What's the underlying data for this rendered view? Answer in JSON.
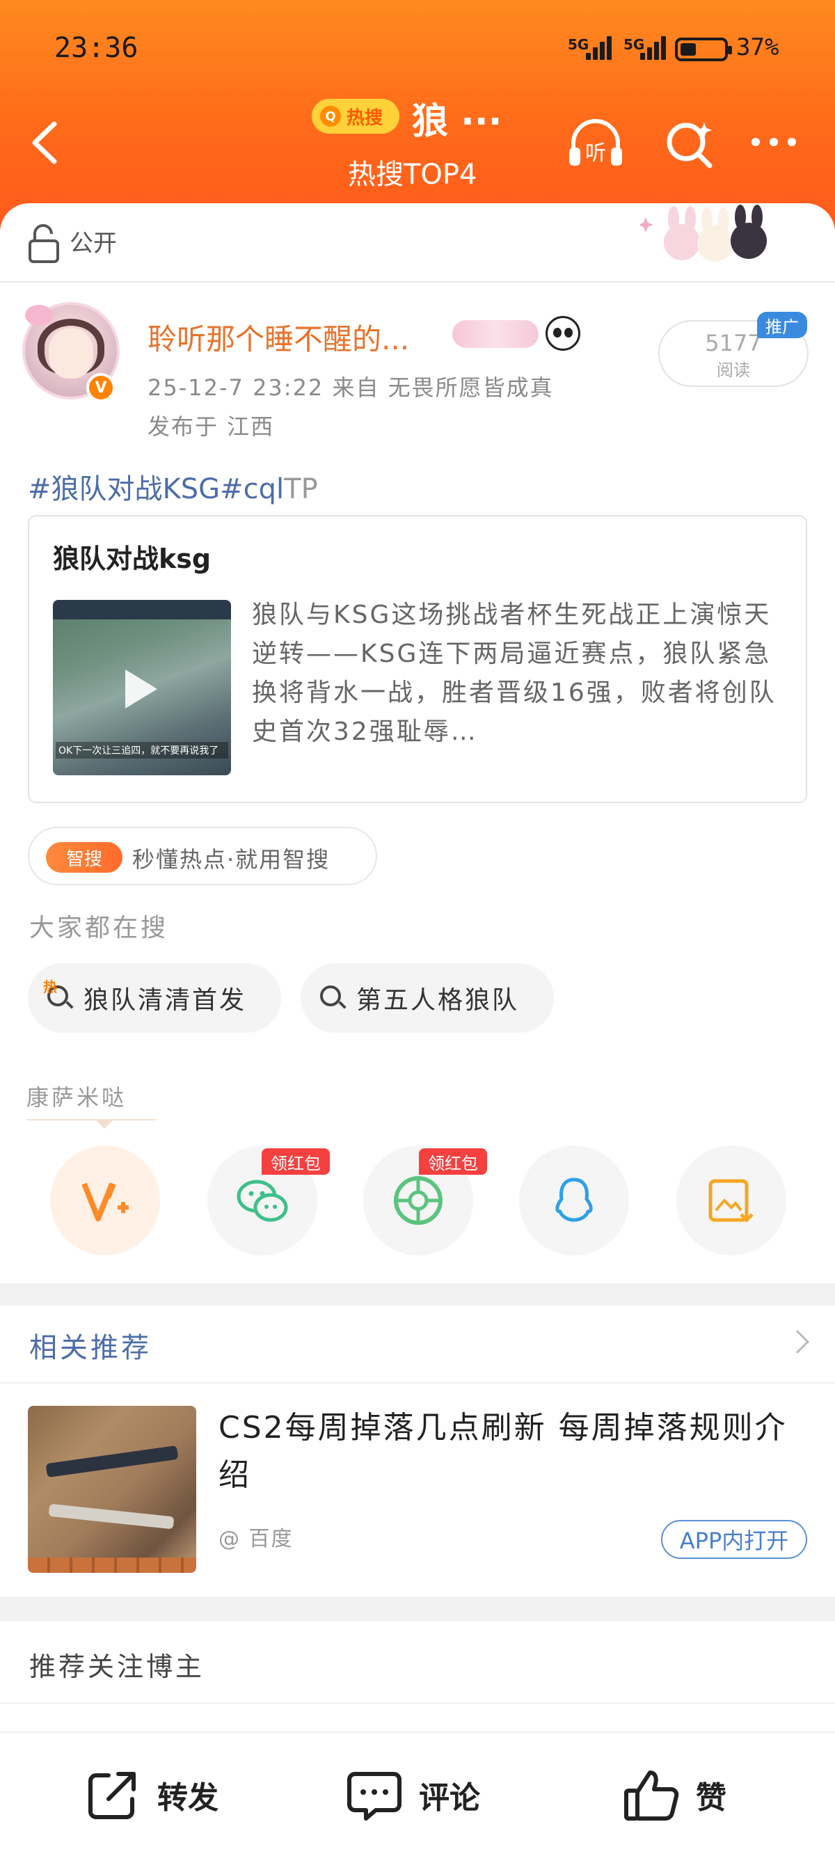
{
  "status_bar": {
    "time": "23:36",
    "network1": "5G",
    "network2": "5G",
    "battery_text": "37%",
    "battery_level": 0.37
  },
  "header": {
    "hot_badge": "热搜",
    "title": "狼 ···",
    "subtitle": "热搜TOP4",
    "listen_label": "听"
  },
  "visibility": "公开",
  "post": {
    "username": "聆听那个睡不醒的...",
    "verified_badge": "V",
    "meta": "25-12-7 23:22  来自 无畏所愿皆成真",
    "location": "发布于 江西",
    "reads_count": "5177",
    "reads_label": "阅读",
    "promo_tag": "推广",
    "hashtags": "#狼队对战KSG#cql",
    "hashtag_fade": "TP"
  },
  "article": {
    "title": "狼队对战ksg",
    "thumb_caption": "OK下一次让三追四，就不要再说我了",
    "body": "狼队与KSG这场挑战者杯生死战正上演惊天逆转——KSG连下两局逼近赛点，狼队紧急换将背水一战，胜者晋级16强，败者将创队史首次32强耻辱…"
  },
  "zhisou": {
    "badge": "智搜",
    "text": "秒懂热点·就用智搜"
  },
  "everyone_search": {
    "label": "大家都在搜",
    "items": [
      "狼队清清首发",
      "第五人格狼队"
    ],
    "hot_mark": "热"
  },
  "share": {
    "section_label": "康萨米哒",
    "red_packet_label": "领红包",
    "targets": [
      "v-plus-icon",
      "wechat-icon",
      "moments-icon",
      "qq-icon",
      "save-image-icon"
    ]
  },
  "related": {
    "title": "相关推荐",
    "item": {
      "headline": "CS2每周掉落几点刷新 每周掉落规则介绍",
      "source": "@ 百度",
      "open_button": "APP内打开"
    }
  },
  "recommend_follow": {
    "title": "推荐关注博主"
  },
  "bottom_bar": {
    "repost": "转发",
    "comment": "评论",
    "like": "赞"
  },
  "colors": {
    "header_orange": "#ff6a1a",
    "username_orange": "#e8732c",
    "link_blue": "#4d6da8",
    "red_tag": "#f54040"
  }
}
